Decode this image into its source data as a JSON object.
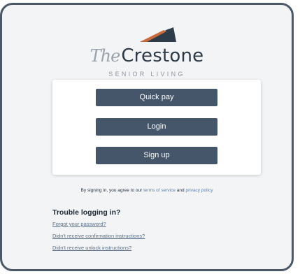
{
  "brand": {
    "the": "The",
    "name": "Crestone",
    "subtitle": "SENIOR LIVING",
    "colors": {
      "mark_dark": "#2e3b48",
      "mark_orange": "#c96a3a",
      "button": "#46566a"
    }
  },
  "buttons": {
    "quick_pay": "Quick pay",
    "login": "Login",
    "sign_up": "Sign up"
  },
  "terms": {
    "prefix": "By signing in, you agree to our ",
    "terms_link": "terms of service",
    "middle": " and ",
    "privacy_link": "privacy policy"
  },
  "help": {
    "title": "Trouble logging in?",
    "forgot_password": "Forgot your password?",
    "confirmation": "Didn't receive confirmation instructions?",
    "unlock": "Didn't receive unlock instructions?"
  }
}
